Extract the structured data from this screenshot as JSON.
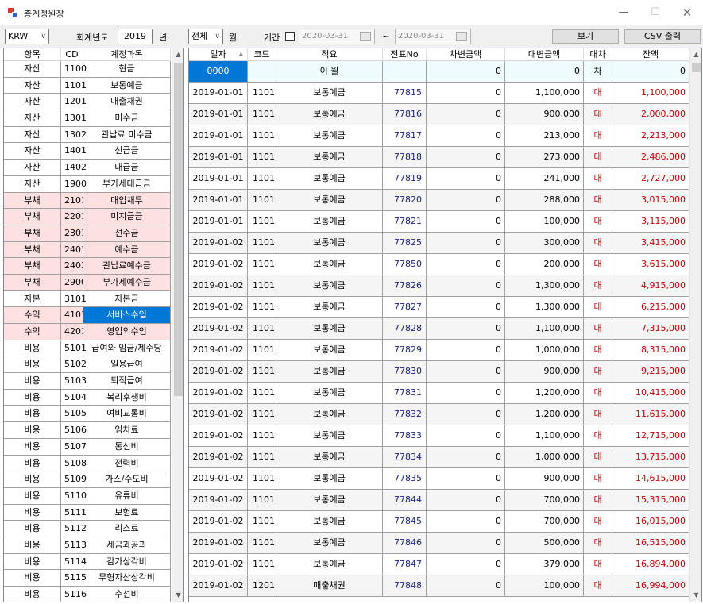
{
  "window": {
    "title": "총계정원장"
  },
  "toolbar": {
    "currency": "KRW",
    "fiscal_year_label": "회계년도",
    "fiscal_year": "2019",
    "year_unit": "년",
    "month_value": "전체",
    "month_unit": "월",
    "period_label": "기간",
    "date_from": "2020-03-31",
    "tilde": "~",
    "date_to": "2020-03-31",
    "view_label": "보기",
    "csv_label": "CSV 출력"
  },
  "account_grid": {
    "headers": [
      "항목",
      "CD",
      "계정과목"
    ],
    "rows": [
      {
        "cat": "자산",
        "cd": "1100",
        "name": "현금",
        "liab": false
      },
      {
        "cat": "자산",
        "cd": "1101",
        "name": "보통예금",
        "liab": false
      },
      {
        "cat": "자산",
        "cd": "1201",
        "name": "매출채권",
        "liab": false
      },
      {
        "cat": "자산",
        "cd": "1301",
        "name": "미수금",
        "liab": false
      },
      {
        "cat": "자산",
        "cd": "1302",
        "name": "관납료 미수금",
        "liab": false
      },
      {
        "cat": "자산",
        "cd": "1401",
        "name": "선급금",
        "liab": false
      },
      {
        "cat": "자산",
        "cd": "1402",
        "name": "대급금",
        "liab": false
      },
      {
        "cat": "자산",
        "cd": "1900",
        "name": "부가세대급금",
        "liab": false
      },
      {
        "cat": "부채",
        "cd": "2101",
        "name": "매입채무",
        "liab": true
      },
      {
        "cat": "부채",
        "cd": "2201",
        "name": "미지급금",
        "liab": true
      },
      {
        "cat": "부채",
        "cd": "2301",
        "name": "선수금",
        "liab": true
      },
      {
        "cat": "부채",
        "cd": "2401",
        "name": "예수금",
        "liab": true
      },
      {
        "cat": "부채",
        "cd": "2403",
        "name": "관납료예수금",
        "liab": true
      },
      {
        "cat": "부채",
        "cd": "2900",
        "name": "부가세예수금",
        "liab": true
      },
      {
        "cat": "자본",
        "cd": "3101",
        "name": "자본금",
        "liab": false
      },
      {
        "cat": "수익",
        "cd": "4101",
        "name": "서비스수입",
        "liab": true,
        "selected": true
      },
      {
        "cat": "수익",
        "cd": "4201",
        "name": "영업외수입",
        "liab": true
      },
      {
        "cat": "비용",
        "cd": "5101",
        "name": "급여와 임금/제수당",
        "liab": false
      },
      {
        "cat": "비용",
        "cd": "5102",
        "name": "일용급여",
        "liab": false
      },
      {
        "cat": "비용",
        "cd": "5103",
        "name": "퇴직급여",
        "liab": false
      },
      {
        "cat": "비용",
        "cd": "5104",
        "name": "복리후생비",
        "liab": false
      },
      {
        "cat": "비용",
        "cd": "5105",
        "name": "여비교통비",
        "liab": false
      },
      {
        "cat": "비용",
        "cd": "5106",
        "name": "임차료",
        "liab": false
      },
      {
        "cat": "비용",
        "cd": "5107",
        "name": "통신비",
        "liab": false
      },
      {
        "cat": "비용",
        "cd": "5108",
        "name": "전력비",
        "liab": false
      },
      {
        "cat": "비용",
        "cd": "5109",
        "name": "가스/수도비",
        "liab": false
      },
      {
        "cat": "비용",
        "cd": "5110",
        "name": "유류비",
        "liab": false
      },
      {
        "cat": "비용",
        "cd": "5111",
        "name": "보험료",
        "liab": false
      },
      {
        "cat": "비용",
        "cd": "5112",
        "name": "리스료",
        "liab": false
      },
      {
        "cat": "비용",
        "cd": "5113",
        "name": "세금과공과",
        "liab": false
      },
      {
        "cat": "비용",
        "cd": "5114",
        "name": "감가상각비",
        "liab": false
      },
      {
        "cat": "비용",
        "cd": "5115",
        "name": "무형자산상각비",
        "liab": false
      },
      {
        "cat": "비용",
        "cd": "5116",
        "name": "수선비",
        "liab": false
      }
    ]
  },
  "ledger_grid": {
    "headers": [
      "일자",
      "코드",
      "적요",
      "전표No",
      "차변금액",
      "대변금액",
      "대차",
      "잔액"
    ],
    "rows": [
      {
        "date": "0000",
        "code": "",
        "desc": "이    월",
        "vno": "",
        "debit": "0",
        "credit": "0",
        "dc": "차",
        "balance": "0",
        "opening": true
      },
      {
        "date": "2019-01-01",
        "code": "1101",
        "desc": "보통예금",
        "vno": "77815",
        "debit": "0",
        "credit": "1,100,000",
        "dc": "대",
        "balance": "1,100,000"
      },
      {
        "date": "2019-01-01",
        "code": "1101",
        "desc": "보통예금",
        "vno": "77816",
        "debit": "0",
        "credit": "900,000",
        "dc": "대",
        "balance": "2,000,000"
      },
      {
        "date": "2019-01-01",
        "code": "1101",
        "desc": "보통예금",
        "vno": "77817",
        "debit": "0",
        "credit": "213,000",
        "dc": "대",
        "balance": "2,213,000"
      },
      {
        "date": "2019-01-01",
        "code": "1101",
        "desc": "보통예금",
        "vno": "77818",
        "debit": "0",
        "credit": "273,000",
        "dc": "대",
        "balance": "2,486,000"
      },
      {
        "date": "2019-01-01",
        "code": "1101",
        "desc": "보통예금",
        "vno": "77819",
        "debit": "0",
        "credit": "241,000",
        "dc": "대",
        "balance": "2,727,000"
      },
      {
        "date": "2019-01-01",
        "code": "1101",
        "desc": "보통예금",
        "vno": "77820",
        "debit": "0",
        "credit": "288,000",
        "dc": "대",
        "balance": "3,015,000"
      },
      {
        "date": "2019-01-01",
        "code": "1101",
        "desc": "보통예금",
        "vno": "77821",
        "debit": "0",
        "credit": "100,000",
        "dc": "대",
        "balance": "3,115,000"
      },
      {
        "date": "2019-01-02",
        "code": "1101",
        "desc": "보통예금",
        "vno": "77825",
        "debit": "0",
        "credit": "300,000",
        "dc": "대",
        "balance": "3,415,000"
      },
      {
        "date": "2019-01-02",
        "code": "1101",
        "desc": "보통예금",
        "vno": "77850",
        "debit": "0",
        "credit": "200,000",
        "dc": "대",
        "balance": "3,615,000"
      },
      {
        "date": "2019-01-02",
        "code": "1101",
        "desc": "보통예금",
        "vno": "77826",
        "debit": "0",
        "credit": "1,300,000",
        "dc": "대",
        "balance": "4,915,000"
      },
      {
        "date": "2019-01-02",
        "code": "1101",
        "desc": "보통예금",
        "vno": "77827",
        "debit": "0",
        "credit": "1,300,000",
        "dc": "대",
        "balance": "6,215,000"
      },
      {
        "date": "2019-01-02",
        "code": "1101",
        "desc": "보통예금",
        "vno": "77828",
        "debit": "0",
        "credit": "1,100,000",
        "dc": "대",
        "balance": "7,315,000"
      },
      {
        "date": "2019-01-02",
        "code": "1101",
        "desc": "보통예금",
        "vno": "77829",
        "debit": "0",
        "credit": "1,000,000",
        "dc": "대",
        "balance": "8,315,000"
      },
      {
        "date": "2019-01-02",
        "code": "1101",
        "desc": "보통예금",
        "vno": "77830",
        "debit": "0",
        "credit": "900,000",
        "dc": "대",
        "balance": "9,215,000"
      },
      {
        "date": "2019-01-02",
        "code": "1101",
        "desc": "보통예금",
        "vno": "77831",
        "debit": "0",
        "credit": "1,200,000",
        "dc": "대",
        "balance": "10,415,000"
      },
      {
        "date": "2019-01-02",
        "code": "1101",
        "desc": "보통예금",
        "vno": "77832",
        "debit": "0",
        "credit": "1,200,000",
        "dc": "대",
        "balance": "11,615,000"
      },
      {
        "date": "2019-01-02",
        "code": "1101",
        "desc": "보통예금",
        "vno": "77833",
        "debit": "0",
        "credit": "1,100,000",
        "dc": "대",
        "balance": "12,715,000"
      },
      {
        "date": "2019-01-02",
        "code": "1101",
        "desc": "보통예금",
        "vno": "77834",
        "debit": "0",
        "credit": "1,000,000",
        "dc": "대",
        "balance": "13,715,000"
      },
      {
        "date": "2019-01-02",
        "code": "1101",
        "desc": "보통예금",
        "vno": "77835",
        "debit": "0",
        "credit": "900,000",
        "dc": "대",
        "balance": "14,615,000"
      },
      {
        "date": "2019-01-02",
        "code": "1101",
        "desc": "보통예금",
        "vno": "77844",
        "debit": "0",
        "credit": "700,000",
        "dc": "대",
        "balance": "15,315,000"
      },
      {
        "date": "2019-01-02",
        "code": "1101",
        "desc": "보통예금",
        "vno": "77845",
        "debit": "0",
        "credit": "700,000",
        "dc": "대",
        "balance": "16,015,000"
      },
      {
        "date": "2019-01-02",
        "code": "1101",
        "desc": "보통예금",
        "vno": "77846",
        "debit": "0",
        "credit": "500,000",
        "dc": "대",
        "balance": "16,515,000"
      },
      {
        "date": "2019-01-02",
        "code": "1101",
        "desc": "보통예금",
        "vno": "77847",
        "debit": "0",
        "credit": "379,000",
        "dc": "대",
        "balance": "16,894,000"
      },
      {
        "date": "2019-01-02",
        "code": "1201",
        "desc": "매출채권",
        "vno": "77848",
        "debit": "0",
        "credit": "100,000",
        "dc": "대",
        "balance": "16,994,000"
      }
    ]
  },
  "icons": {
    "app": "ledger-app-icon",
    "dropdown": "chevron-down-icon",
    "calendar": "calendar-icon",
    "sort": "sort-ascending-icon",
    "scroll_up": "scroll-up-icon",
    "scroll_down": "scroll-down-icon"
  }
}
